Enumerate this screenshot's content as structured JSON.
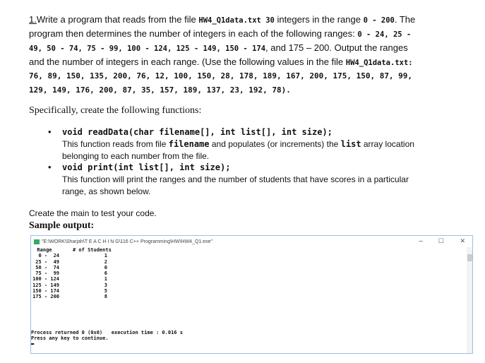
{
  "q": {
    "line1": [
      "1.",
      "Write a program that reads from the file ",
      "HW4_Q1data.txt 30",
      " integers in the range ",
      "0 - 200",
      ". The"
    ],
    "line2": [
      "program then determines the number of integers in each of the following ranges: ",
      "0 - 24, 25 -"
    ],
    "line3": [
      "49, 50 - 74, 75 - 99, 100 - 124, 125 - 149, 150 - 174",
      ", and 175 – 200. Output the ranges"
    ],
    "line4": [
      "and the number of integers in each range. (Use the following values in the file ",
      "HW4_Q1data.txt:"
    ],
    "line5": "76, 89, 150, 135, 200, 76, 12, 100, 150, 28, 178, 189, 167, 200, 175, 150, 87, 99,",
    "line6": "129, 149, 176, 200, 87, 35, 157, 189, 137, 23, 192, 78)."
  },
  "specifically": "Specifically, create the following functions:",
  "functions": [
    {
      "sig": "void readData(char filename[], int list[], int size);",
      "desc": [
        "This function reads from file ",
        "filename",
        " and populates (or increments) the ",
        "list",
        " array location"
      ],
      "desc2": "belonging to each number from the file."
    },
    {
      "sig": "void print(int list[], int size);",
      "desc1": "This function will print the ranges and the number of students that have scores in a particular",
      "desc2": "range, as shown below."
    }
  ],
  "create_main": "Create the main to test your code.",
  "sample_output": "Sample output:",
  "console": {
    "title": "\"E:\\WORK\\Sharjah\\T E A C H I N G\\116 C++ Programming\\HW\\HW4_Q1.exe\"",
    "minimize": "–",
    "maximize": "☐",
    "close": "✕",
    "header": "  Range       # of Students",
    "rows": [
      [
        " 0 -  24",
        "1"
      ],
      [
        "25 -  49",
        "2"
      ],
      [
        "50 -  74",
        "0"
      ],
      [
        "75 -  99",
        "6"
      ],
      [
        "100 - 124",
        "1"
      ],
      [
        "125 - 149",
        "3"
      ],
      [
        "150 - 174",
        "5"
      ],
      [
        "175 - 200",
        "8"
      ]
    ],
    "process": "Process returned 0 (0x0)   execution time : 0.016 s",
    "press": "Press any key to continue.",
    "cursor": "▬"
  }
}
